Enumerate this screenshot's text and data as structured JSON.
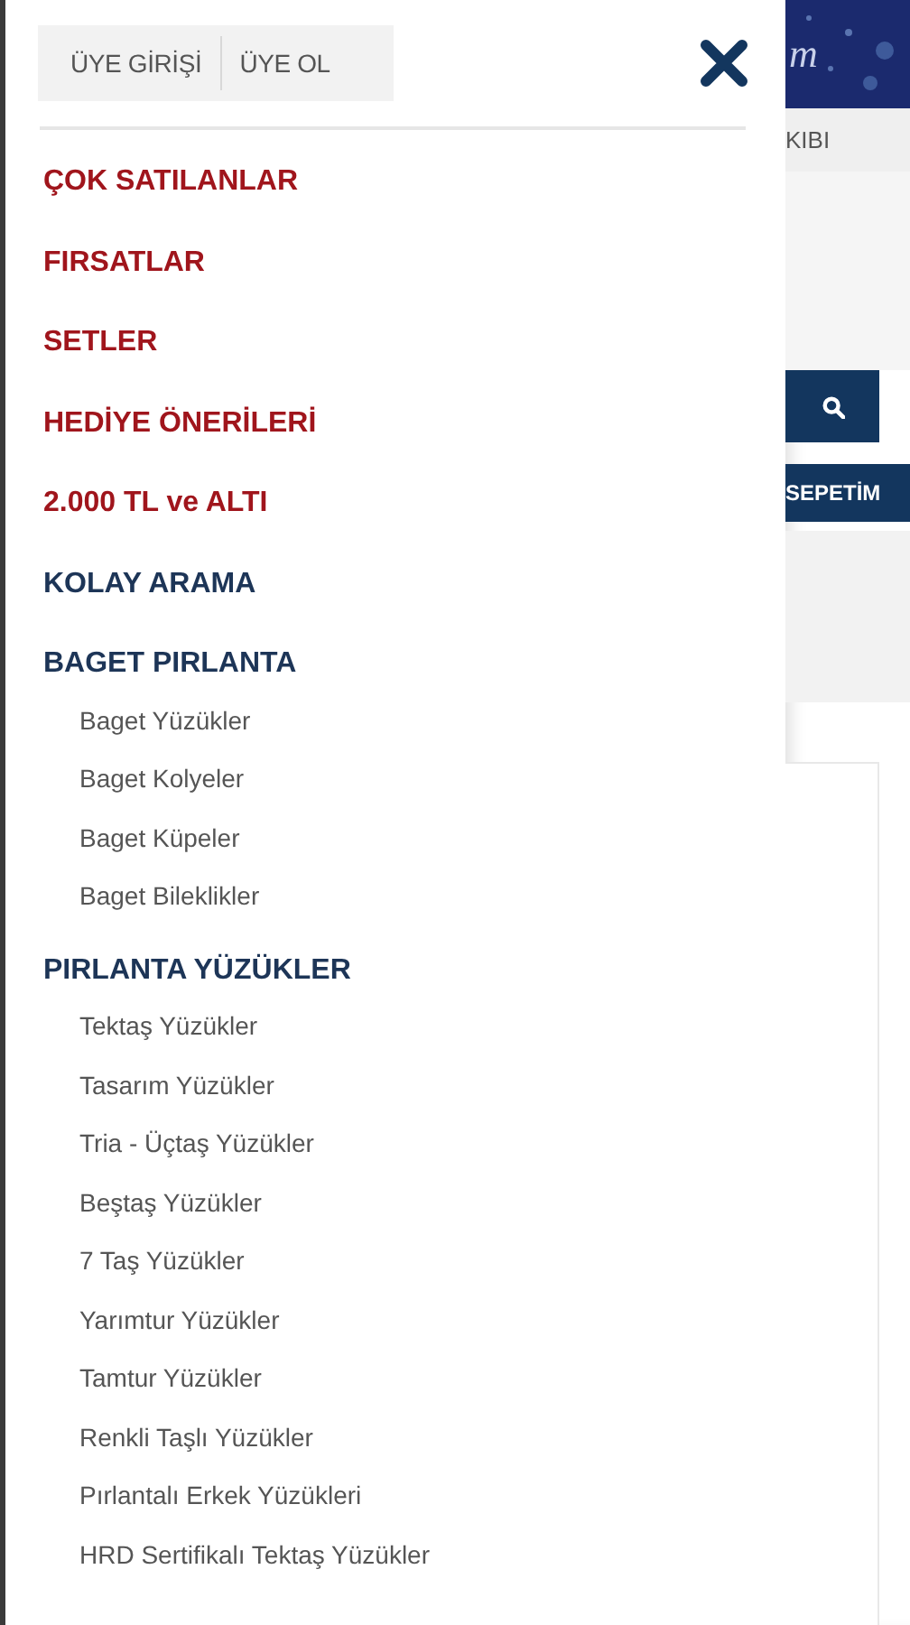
{
  "drawer": {
    "auth_tabs": [
      {
        "label": "ÜYE GİRİŞİ"
      },
      {
        "label": "ÜYE OL"
      }
    ],
    "menu": [
      {
        "label": "ÇOK SATILANLAR",
        "kind": "promo"
      },
      {
        "label": "FIRSATLAR",
        "kind": "promo"
      },
      {
        "label": "SETLER",
        "kind": "promo"
      },
      {
        "label": "HEDİYE ÖNERİLERİ",
        "kind": "promo"
      },
      {
        "label": "2.000 TL ve ALTI",
        "kind": "promo"
      },
      {
        "label": "KOLAY ARAMA",
        "kind": "category"
      },
      {
        "label": "BAGET PIRLANTA",
        "kind": "category",
        "children": [
          {
            "label": "Baget Yüzükler"
          },
          {
            "label": "Baget Kolyeler"
          },
          {
            "label": "Baget Küpeler"
          },
          {
            "label": "Baget Bileklikler"
          }
        ]
      },
      {
        "label": "PIRLANTA YÜZÜKLER",
        "kind": "category",
        "children": [
          {
            "label": "Tektaş Yüzükler"
          },
          {
            "label": "Tasarım Yüzükler"
          },
          {
            "label": "Tria - Üçtaş Yüzükler"
          },
          {
            "label": "Beştaş Yüzükler"
          },
          {
            "label": "7 Taş Yüzükler"
          },
          {
            "label": "Yarımtur Yüzükler"
          },
          {
            "label": "Tamtur Yüzükler"
          },
          {
            "label": "Renkli Taşlı Yüzükler"
          },
          {
            "label": "Pırlantalı Erkek Yüzükleri"
          },
          {
            "label": "HRD Sertifikalı Tektaş Yüzükler"
          }
        ]
      }
    ]
  },
  "background_page": {
    "banner_text": "m",
    "nav_text": "KIBI",
    "cart_button": "SEPETİM"
  }
}
